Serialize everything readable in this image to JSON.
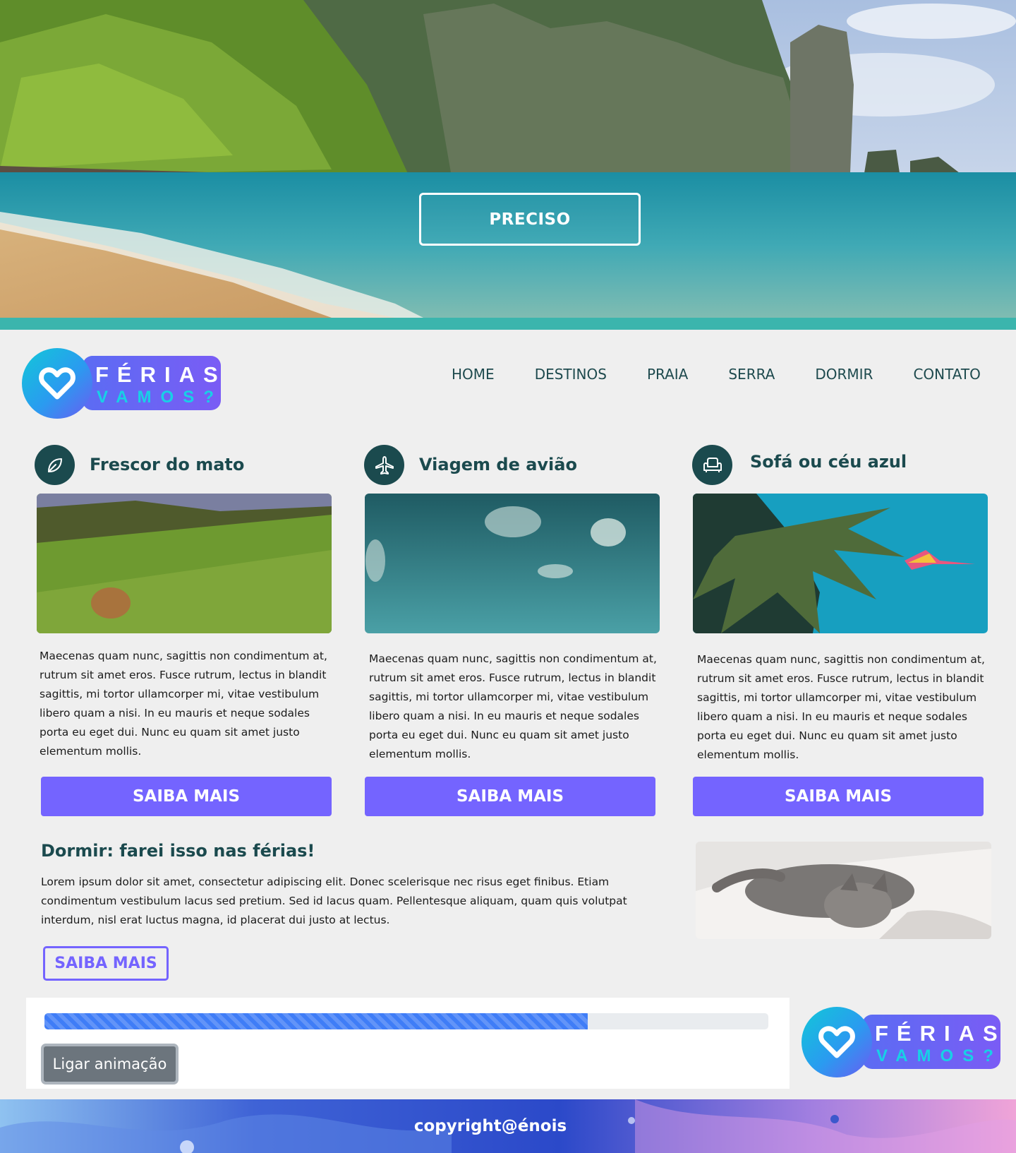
{
  "hero": {
    "button_label": "PRECISO"
  },
  "brand": {
    "word1": "FÉRIAS",
    "word2": "VAMOS?"
  },
  "nav": {
    "items": [
      "HOME",
      "DESTINOS",
      "PRAIA",
      "SERRA",
      "DORMIR",
      "CONTATO"
    ]
  },
  "cards": [
    {
      "icon": "leaf-icon",
      "title": "Frescor do mato",
      "text": "Maecenas quam nunc, sagittis non condimentum at, rutrum sit amet eros. Fusce rutrum, lectus in blandit sagittis, mi tortor ullamcorper mi, vitae vestibulum libero quam a nisi. In eu mauris et neque sodales porta eu eget dui. Nunc eu quam sit amet justo elementum mollis.",
      "button": "SAIBA MAIS"
    },
    {
      "icon": "airplane-icon",
      "title": "Viagem de avião",
      "text": "Maecenas quam nunc, sagittis non condimentum at, rutrum sit amet eros. Fusce rutrum, lectus in blandit sagittis, mi tortor ullamcorper mi, vitae vestibulum libero quam a nisi. In eu mauris et neque sodales porta eu eget dui. Nunc eu quam sit amet justo elementum mollis.",
      "button": "SAIBA MAIS"
    },
    {
      "icon": "armchair-icon",
      "title": "Sofá ou céu azul",
      "text": "Maecenas quam nunc, sagittis non condimentum at, rutrum sit amet eros. Fusce rutrum, lectus in blandit sagittis, mi tortor ullamcorper mi, vitae vestibulum libero quam a nisi. In eu mauris et neque sodales porta eu eget dui. Nunc eu quam sit amet justo elementum mollis.",
      "button": "SAIBA MAIS"
    }
  ],
  "dormir": {
    "title": "Dormir: farei isso nas férias!",
    "text": "Lorem ipsum dolor sit amet, consectetur adipiscing elit. Donec scelerisque nec risus eget finibus. Etiam condimentum vestibulum lacus sed pretium. Sed id lacus quam. Pellentesque aliquam, quam quis volutpat interdum, nisl erat luctus magna, id placerat dui justo at lectus.",
    "button": "SAIBA MAIS"
  },
  "progress": {
    "value_percent": 75,
    "button_label": "Ligar animação"
  },
  "footer": {
    "copyright": "copyright@énois"
  },
  "colors": {
    "accent": "#7464ff",
    "dark_teal": "#1b4a4e",
    "teal_bar": "#3bb5ad",
    "progress_fill": "#3f7df7",
    "page_bg": "#efefef"
  }
}
